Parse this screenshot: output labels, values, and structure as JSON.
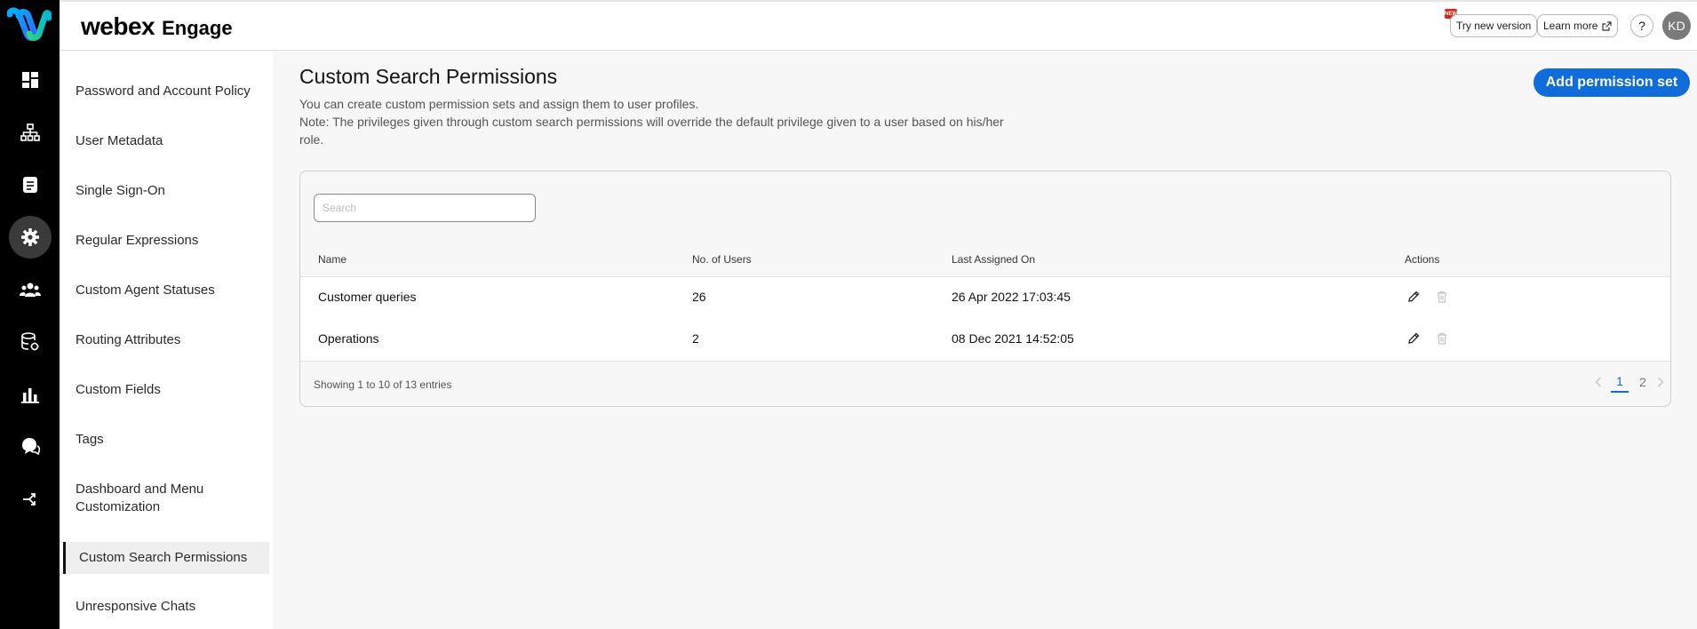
{
  "topbar": {
    "brand_main": "webex",
    "brand_sub": "Engage",
    "new_badge": "NEW",
    "try_new_version": "Try new version",
    "learn_more": "Learn more",
    "help": "?",
    "avatar_initials": "KD"
  },
  "rail": {
    "icons": [
      "dashboard-icon",
      "hierarchy-icon",
      "document-icon",
      "settings-icon",
      "people-icon",
      "database-icon",
      "reports-icon",
      "chat-icon",
      "routing-icon"
    ],
    "active": "settings-icon"
  },
  "sidebar": {
    "items": [
      {
        "label": "Password and Account Policy"
      },
      {
        "label": "User Metadata"
      },
      {
        "label": "Single Sign-On"
      },
      {
        "label": "Regular Expressions"
      },
      {
        "label": "Custom Agent Statuses"
      },
      {
        "label": "Routing Attributes"
      },
      {
        "label": "Custom Fields"
      },
      {
        "label": "Tags"
      },
      {
        "label": "Dashboard and Menu Customization"
      },
      {
        "label": "Custom Search Permissions"
      },
      {
        "label": "Unresponsive Chats"
      }
    ],
    "active": "Custom Search Permissions"
  },
  "main": {
    "title": "Custom Search Permissions",
    "desc_line1": "You can create custom permission sets and assign them to user profiles.",
    "desc_line2": "Note: The privileges given through custom search permissions will override the default privilege given to a user based on his/her role.",
    "add_button": "Add permission set",
    "search_placeholder": "Search",
    "columns": [
      "Name",
      "No. of Users",
      "Last Assigned On",
      "Actions"
    ],
    "rows": [
      {
        "name": "Customer queries",
        "users": "26",
        "last_assigned": "26 Apr 2022 17:03:45"
      },
      {
        "name": "Operations",
        "users": "2",
        "last_assigned": "08 Dec 2021 14:52:05"
      }
    ],
    "entries_text": "Showing 1 to 10 of 13 entries",
    "pages": [
      "1",
      "2"
    ],
    "current_page": "1"
  },
  "colors": {
    "primary": "#0f6cd8",
    "rail_bg": "#000000",
    "badge": "#d0271d"
  }
}
